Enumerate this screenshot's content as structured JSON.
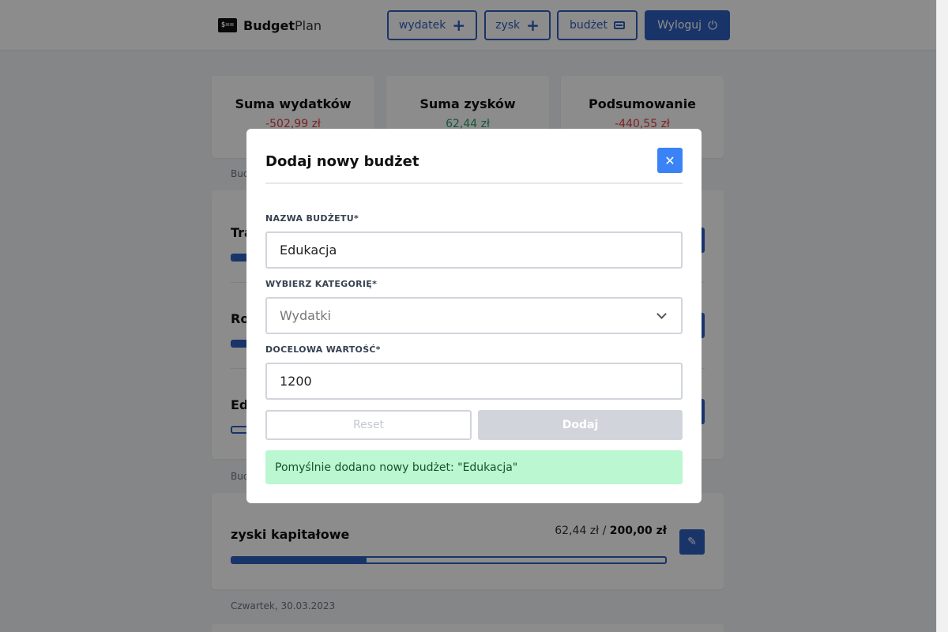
{
  "header": {
    "logo_icon_text": "$==",
    "logo_bold": "Budget",
    "logo_regular": "Plan",
    "buttons": {
      "expense": "wydatek",
      "profit": "zysk",
      "budget": "budżet",
      "logout": "Wyloguj"
    },
    "brand_color": "#2f5fbf"
  },
  "summary": {
    "expenses_title": "Suma wydatków",
    "expenses_value": "-502,99 zł",
    "profits_title": "Suma zysków",
    "profits_value": "62,44 zł",
    "overview_title": "Podsumowanie",
    "overview_value": "-440,55 zł"
  },
  "budgets_label": "Bud",
  "budget_rows": [
    {
      "title": "Tra",
      "progress": 0.05
    },
    {
      "title": "Ro",
      "progress": 0.05
    },
    {
      "title": "Ed",
      "progress": 0.0
    }
  ],
  "profit_budgets_label": "Bud",
  "profit_card": {
    "title": "zyski kapitałowe",
    "current": "62,44 zł",
    "separator": " / ",
    "target": "200,00 zł",
    "progress": 0.31
  },
  "date_label": "Czwartek, 30.03.2023",
  "modal": {
    "title": "Dodaj nowy budżet",
    "close_symbol": "✕",
    "name_label": "NAZWA BUDŻETU*",
    "name_value": "Edukacja",
    "category_label": "WYBIERZ KATEGORIĘ*",
    "category_value": "Wydatki",
    "target_label": "DOCELOWA WARTOŚĆ*",
    "target_value": "1200",
    "reset_label": "Reset",
    "add_label": "Dodaj",
    "success_message": "Pomyślnie dodano nowy budżet: \"Edukacja\""
  }
}
